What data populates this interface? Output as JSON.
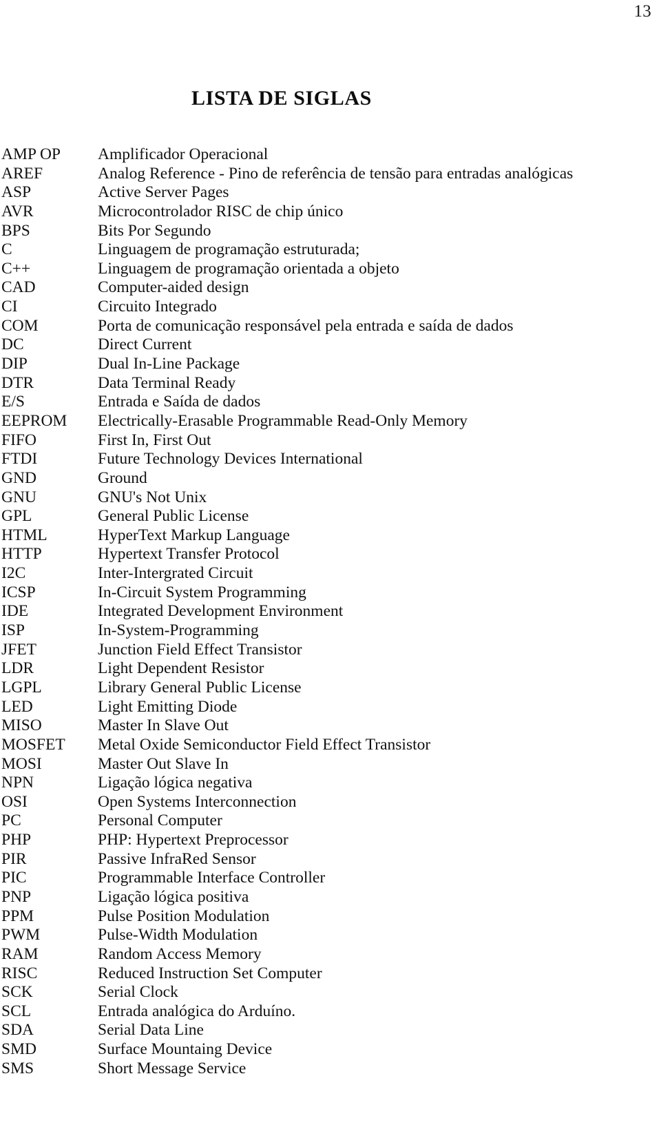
{
  "page": {
    "number": "13",
    "title": "LISTA DE SIGLAS"
  },
  "siglas": [
    {
      "term": "AMP OP",
      "definition": "Amplificador Operacional"
    },
    {
      "term": "AREF",
      "definition": "Analog Reference - Pino de referência de tensão para entradas analógicas"
    },
    {
      "term": "ASP",
      "definition": "Active Server Pages"
    },
    {
      "term": "AVR",
      "definition": "Microcontrolador RISC de chip único"
    },
    {
      "term": "BPS",
      "definition": "Bits Por Segundo"
    },
    {
      "term": "C",
      "definition": "Linguagem de programação estruturada;"
    },
    {
      "term": "C++",
      "definition": "Linguagem de programação orientada a objeto"
    },
    {
      "term": "CAD",
      "definition": "Computer-aided design"
    },
    {
      "term": "CI",
      "definition": "Circuito Integrado"
    },
    {
      "term": "COM",
      "definition": "Porta de comunicação responsável pela entrada e saída de dados"
    },
    {
      "term": "DC",
      "definition": "Direct Current"
    },
    {
      "term": "DIP",
      "definition": "Dual In-Line Package"
    },
    {
      "term": "DTR",
      "definition": "Data Terminal Ready"
    },
    {
      "term": "E/S",
      "definition": "Entrada e Saída de dados"
    },
    {
      "term": "EEPROM",
      "definition": "Electrically-Erasable Programmable Read-Only Memory"
    },
    {
      "term": "FIFO",
      "definition": "First In, First Out"
    },
    {
      "term": "FTDI",
      "definition": "Future Technology Devices International"
    },
    {
      "term": "GND",
      "definition": "Ground"
    },
    {
      "term": "GNU",
      "definition": "GNU's Not Unix"
    },
    {
      "term": "GPL",
      "definition": "General Public License"
    },
    {
      "term": "HTML",
      "definition": "HyperText Markup Language"
    },
    {
      "term": "HTTP",
      "definition": "Hypertext Transfer Protocol"
    },
    {
      "term": "I2C",
      "definition": "Inter-Intergrated Circuit"
    },
    {
      "term": "ICSP",
      "definition": "In-Circuit System Programming"
    },
    {
      "term": "IDE",
      "definition": "Integrated Development Environment"
    },
    {
      "term": "ISP",
      "definition": "In-System-Programming"
    },
    {
      "term": "JFET",
      "definition": "Junction Field Effect Transistor"
    },
    {
      "term": "LDR",
      "definition": "Light Dependent Resistor"
    },
    {
      "term": "LGPL",
      "definition": "Library General Public License"
    },
    {
      "term": "LED",
      "definition": "Light Emitting Diode"
    },
    {
      "term": "MISO",
      "definition": "Master In Slave Out"
    },
    {
      "term": "MOSFET",
      "definition": "Metal Oxide Semiconductor Field Effect Transistor"
    },
    {
      "term": "MOSI",
      "definition": "Master Out Slave In"
    },
    {
      "term": "NPN",
      "definition": "Ligação lógica negativa"
    },
    {
      "term": "OSI",
      "definition": "Open Systems Interconnection"
    },
    {
      "term": "PC",
      "definition": "Personal Computer"
    },
    {
      "term": "PHP",
      "definition": "PHP: Hypertext Preprocessor"
    },
    {
      "term": "PIR",
      "definition": "Passive InfraRed Sensor"
    },
    {
      "term": "PIC",
      "definition": "Programmable Interface Controller"
    },
    {
      "term": "PNP",
      "definition": "Ligação lógica positiva"
    },
    {
      "term": "PPM",
      "definition": "Pulse Position Modulation"
    },
    {
      "term": "PWM",
      "definition": "Pulse-Width Modulation"
    },
    {
      "term": "RAM",
      "definition": "Random Access Memory"
    },
    {
      "term": "RISC",
      "definition": "Reduced Instruction Set Computer"
    },
    {
      "term": "SCK",
      "definition": "Serial Clock"
    },
    {
      "term": "SCL",
      "definition": "Entrada analógica do Arduíno."
    },
    {
      "term": "SDA",
      "definition": "Serial Data Line"
    },
    {
      "term": "SMD",
      "definition": "Surface Mountaing Device"
    },
    {
      "term": "SMS",
      "definition": "Short Message Service"
    }
  ]
}
